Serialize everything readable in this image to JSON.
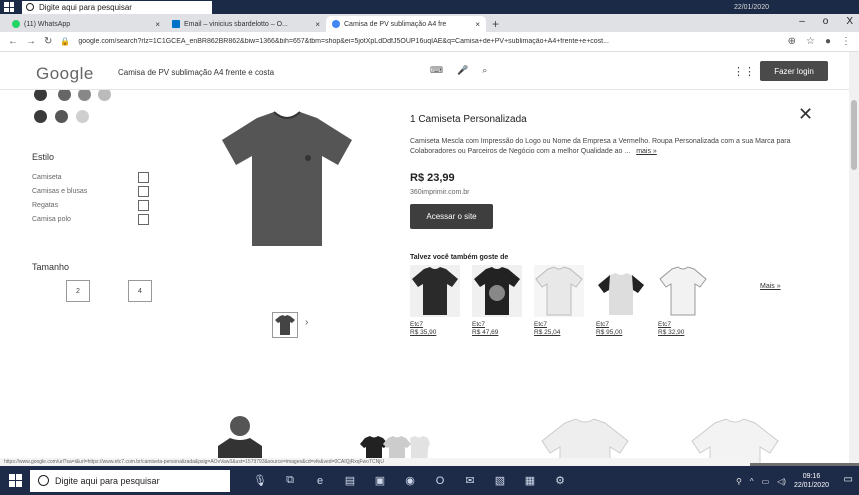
{
  "top_taskbar": {
    "search_placeholder": "Digite aqui para pesquisar",
    "date": "22/01/2020"
  },
  "browser": {
    "tabs": [
      {
        "label": "(11) WhatsApp",
        "color": "#25d366"
      },
      {
        "label": "Email – vinicius sbardelotto – O...",
        "color": "#0072c6"
      },
      {
        "label": "Camisa de PV sublimação A4 fre",
        "color": "#4285f4"
      }
    ],
    "new_tab": "+",
    "window_controls": [
      "–",
      "o",
      "X"
    ],
    "url": "google.com/search?rlz=1C1GCEA_enBR862BR862&biw=1366&bih=657&tbm=shop&ei=5jotXpLdDdfJ5OUP16uqIAE&q=Camisa+de+PV+sublimação+A4+frente+e+cost..."
  },
  "google": {
    "logo": "Google",
    "query": "Camisa de PV sublimação A4 frente e costa",
    "login": "Fazer login"
  },
  "sidebar": {
    "colors": [
      "#3a3a3a",
      "#5a5a5a",
      "#cfcfcf"
    ],
    "style_title": "Estilo",
    "styles": [
      "Camiseta",
      "Camisas e blusas",
      "Regatas",
      "Camisa polo"
    ],
    "size_title": "Tamanho",
    "sizes": [
      "2",
      "4"
    ]
  },
  "product": {
    "title": "1 Camiseta Personalizada",
    "description": "Camiseta Mescla com Impressão do Logo ou Nome da Empresa a Vermelho. Roupa Personalizada com a sua Marca para Colaboradores ou Parceiros de Negócio com a melhor Qualidade ao ...",
    "more": "mais »",
    "price": "R$ 23,99",
    "seller": "360imprimir.com.br",
    "visit": "Acessar o site"
  },
  "related": {
    "title": "Talvez você também goste de",
    "items": [
      {
        "name": "Etc7",
        "price": "R$ 35,90"
      },
      {
        "name": "Etc7",
        "price": "R$ 47,69"
      },
      {
        "name": "Etc7",
        "price": "R$ 25,04"
      },
      {
        "name": "Etc7",
        "price": "R$ 95,00"
      },
      {
        "name": "Etc7",
        "price": "R$ 32,90"
      }
    ],
    "more": "Mais »"
  },
  "status_url": "https://www.google.com/url?sa=i&url=https://www.etc7.com.br/camiseta-personalizada&psig=AOvVaw3&ust=1579793&source=images&cd=vfe&ved=0CAIQjRxqFwoTCNjU",
  "taskbar": {
    "search_placeholder": "Digite aqui para pesquisar",
    "time": "09:16",
    "date": "22/01/2020"
  }
}
